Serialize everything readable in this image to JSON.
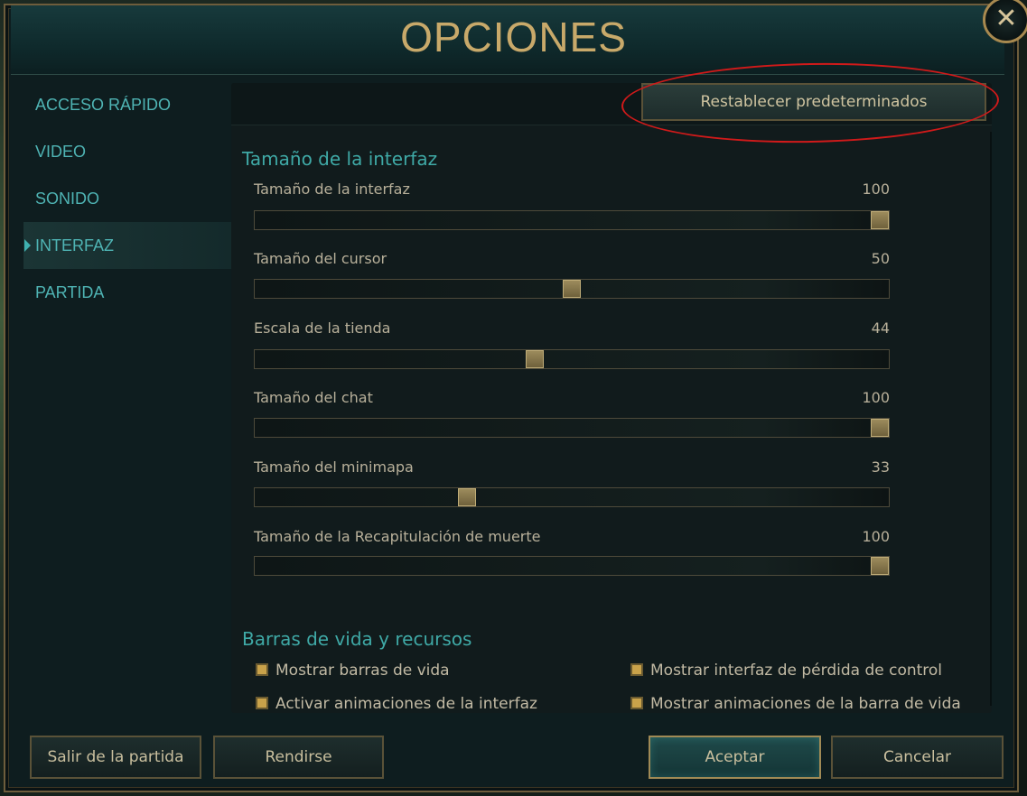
{
  "window": {
    "title": "OPCIONES",
    "close_glyph": "✕",
    "close_icon": "close-icon"
  },
  "sidebar": {
    "items": [
      {
        "label": "ACCESO RÁPIDO",
        "active": false
      },
      {
        "label": "VIDEO",
        "active": false
      },
      {
        "label": "SONIDO",
        "active": false
      },
      {
        "label": "INTERFAZ",
        "active": true
      },
      {
        "label": "PARTIDA",
        "active": false
      }
    ]
  },
  "panel": {
    "reset_label": "Restablecer predeterminados",
    "sections": [
      {
        "heading": "Tamaño de la interfaz",
        "sliders": [
          {
            "label": "Tamaño de la interfaz",
            "value": "100",
            "level": 1.0
          },
          {
            "label": "Tamaño del cursor",
            "value": "50",
            "level": 0.5
          },
          {
            "label": "Escala de la tienda",
            "value": "44",
            "level": 0.44
          },
          {
            "label": "Tamaño del chat",
            "value": "100",
            "level": 1.0
          },
          {
            "label": "Tamaño del minimapa",
            "value": "33",
            "level": 0.33
          },
          {
            "label": "Tamaño de la Recapitulación de muerte",
            "value": "100",
            "level": 1.0
          }
        ]
      },
      {
        "heading": "Barras de vida y recursos",
        "checkboxes": [
          {
            "label": "Mostrar barras de vida",
            "checked": true
          },
          {
            "label": "Mostrar interfaz de pérdida de control",
            "checked": true
          },
          {
            "label": "Activar animaciones de la interfaz",
            "checked": true
          },
          {
            "label": "Mostrar animaciones de la barra de vida",
            "checked": true
          }
        ]
      }
    ]
  },
  "footer": {
    "leave_label": "Salir de la partida",
    "surrender_label": "Rendirse",
    "accept_label": "Aceptar",
    "cancel_label": "Cancelar"
  },
  "colors": {
    "accent_teal": "#3fa9a6",
    "gold": "#c8a96a",
    "annotation_red": "#d01a1a"
  }
}
